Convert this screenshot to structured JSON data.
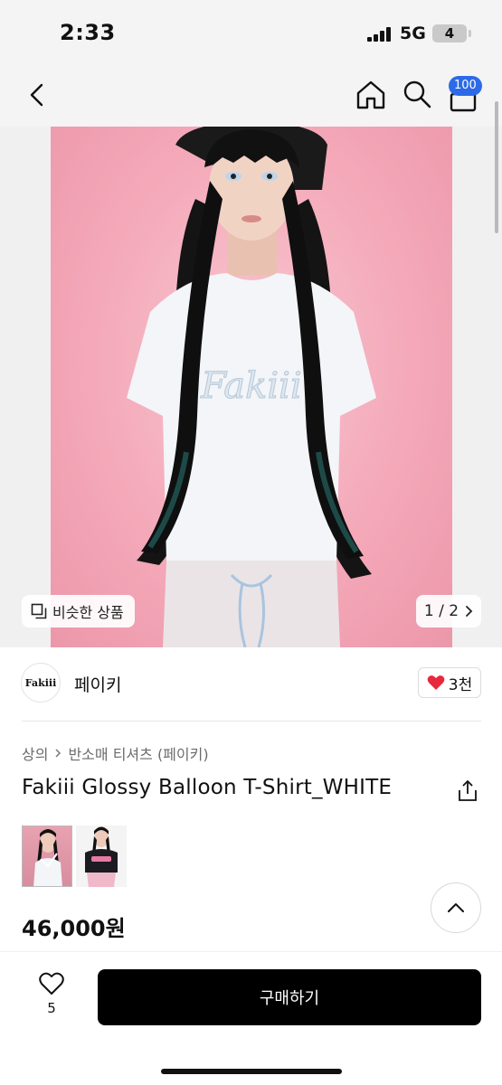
{
  "status_bar": {
    "time": "2:33",
    "network": "5G",
    "battery": "4"
  },
  "nav": {
    "cart_count": "100"
  },
  "gallery": {
    "similar_label": "비슷한 상품",
    "pager_text": "1 / 2"
  },
  "seller": {
    "logo_text": "Fakiii",
    "name": "페이키",
    "likes": "3천"
  },
  "product": {
    "breadcrumb": [
      "상의",
      "반소매 티셔츠 (페이키)"
    ],
    "title": "Fakiii Glossy Balloon T-Shirt_WHITE",
    "price": "46,000원",
    "thumbnails": [
      "white-shirt",
      "black-shirt"
    ]
  },
  "bottom_bar": {
    "wish_count": "5",
    "buy_label": "구매하기"
  },
  "colors": {
    "accent": "#2d6ae8",
    "heart": "#e8283c",
    "buy_button": "#000000",
    "photo_bg": "#f5aebf"
  }
}
